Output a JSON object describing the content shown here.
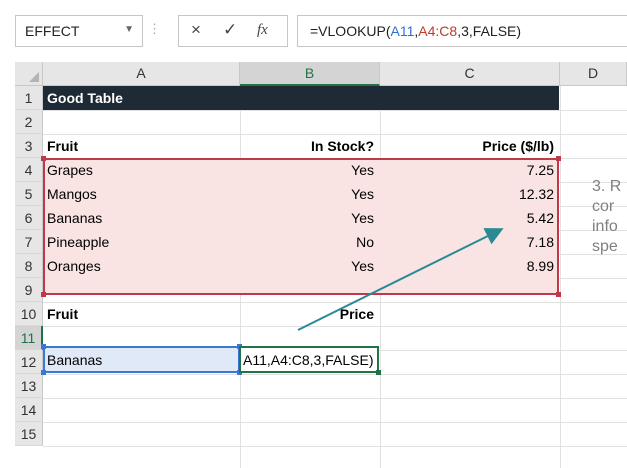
{
  "formula_bar": {
    "name_box": "EFFECT",
    "cancel_icon": "×",
    "enter_icon": "✓",
    "fx_icon": "fx",
    "formula_prefix": "=VLOOKUP(",
    "formula_ref1": "A11",
    "formula_sep1": ",",
    "formula_ref2": "A4:C8",
    "formula_suffix": ",3,FALSE)"
  },
  "columns": [
    "A",
    "B",
    "C",
    "D"
  ],
  "rows": [
    "1",
    "2",
    "3",
    "4",
    "5",
    "6",
    "7",
    "8",
    "9",
    "10",
    "11",
    "12",
    "13",
    "14",
    "15"
  ],
  "sheet": {
    "title": "Good Table",
    "headers": {
      "fruit": "Fruit",
      "in_stock": "In Stock?",
      "price": "Price ($/lb)"
    },
    "table": [
      {
        "fruit": "Grapes",
        "stock": "Yes",
        "price": "7.25"
      },
      {
        "fruit": "Mangos",
        "stock": "Yes",
        "price": "12.32"
      },
      {
        "fruit": "Bananas",
        "stock": "Yes",
        "price": "5.42"
      },
      {
        "fruit": "Pineapple",
        "stock": "No",
        "price": "7.18"
      },
      {
        "fruit": "Oranges",
        "stock": "Yes",
        "price": "8.99"
      }
    ],
    "lookup_header_fruit": "Fruit",
    "lookup_header_price": "Price",
    "lookup_value": "Bananas",
    "edit_text": "A11,A4:C8,3,FALSE)"
  },
  "side_note": [
    "3. R",
    "cor",
    "info",
    "spe"
  ],
  "colors": {
    "table_border": "#c0394a",
    "table_fill": "#f9e3e3",
    "arrow": "#2a8a94",
    "title_bg": "#1e2a36",
    "edit_border": "#217346",
    "lookup_border": "#3a78d4"
  }
}
